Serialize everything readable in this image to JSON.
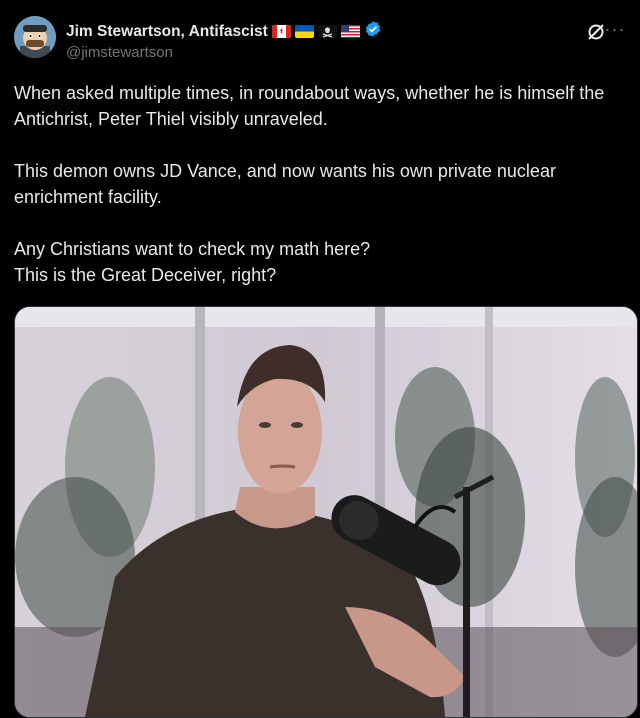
{
  "author": {
    "display_name": "Jim Stewartson, Antifascist",
    "handle": "@jimstewartson",
    "flags": [
      "canada-flag-icon",
      "ukraine-flag-icon",
      "pirate-flag-icon",
      "usa-flag-icon"
    ],
    "verified": true,
    "accent_color": "#1d9bf0"
  },
  "tweet": {
    "paragraphs": [
      "When asked multiple times, in roundabout ways, whether he is himself the Antichrist, Peter Thiel visibly unraveled.",
      "This demon owns JD Vance, and now wants his own private nuclear enrichment facility.",
      "Any Christians want to check my math here?",
      "This is the Great Deceiver, right?"
    ]
  },
  "media": {
    "type": "video-still",
    "subject": "man-with-microphone"
  }
}
